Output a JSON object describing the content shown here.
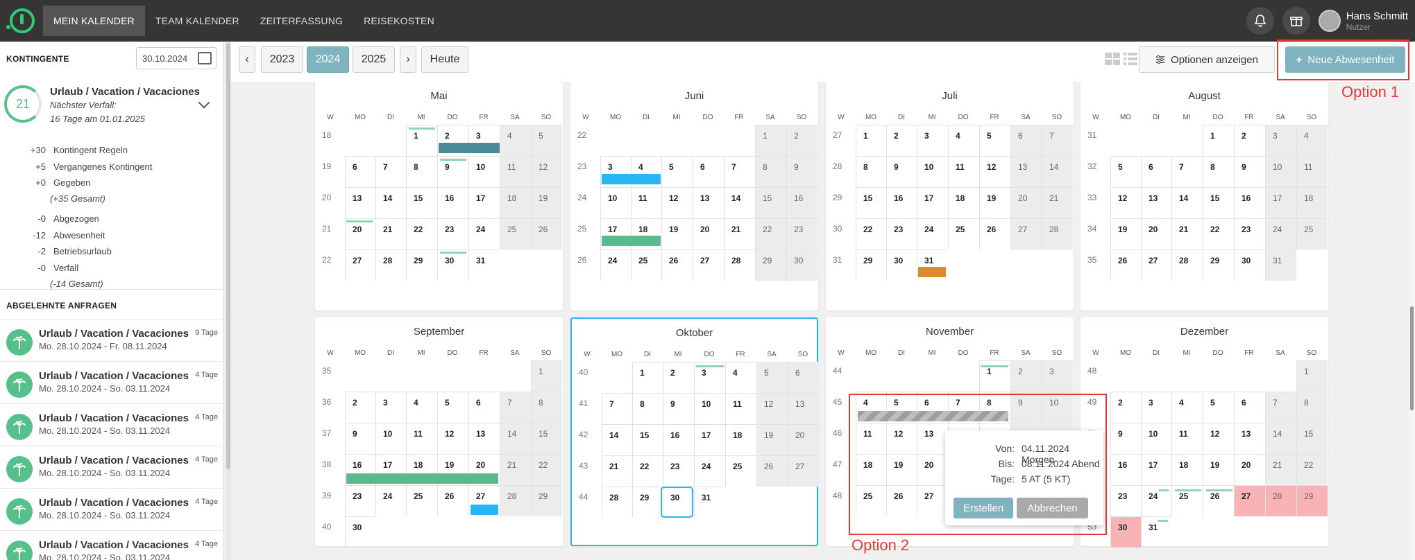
{
  "nav": {
    "items": [
      "MEIN KALENDER",
      "TEAM KALENDER",
      "ZEITERFASSUNG",
      "REISEKOSTEN"
    ],
    "active": 0
  },
  "user": {
    "name": "Hans Schmitt",
    "role": "Nutzer"
  },
  "sidebar": {
    "kontingente_title": "KONTINGENTE",
    "date": "30.10.2024",
    "quota": {
      "value": "21",
      "title": "Urlaub / Vacation / Vacaciones",
      "next_label": "Nächster Verfall:",
      "next_value": "16 Tage am 01.01.2025"
    },
    "rows": [
      {
        "n": "+30",
        "l": "Kontingent Regeln"
      },
      {
        "n": "+5",
        "l": "Vergangenes Kontingent"
      },
      {
        "n": "+0",
        "l": "Gegeben"
      },
      {
        "n": "",
        "l": "(+35 Gesamt)",
        "italic": true
      },
      {
        "n": "-0",
        "l": "Abgezogen"
      },
      {
        "n": "-12",
        "l": "Abwesenheit"
      },
      {
        "n": "-2",
        "l": "Betriebsurlaub"
      },
      {
        "n": "-0",
        "l": "Verfall"
      },
      {
        "n": "",
        "l": "(-14 Gesamt)",
        "italic": true
      }
    ],
    "rejected_title": "ABGELEHNTE ANFRAGEN",
    "requests": [
      {
        "title": "Urlaub / Vacation / Vacaciones",
        "dates": "Mo. 28.10.2024 - Fr. 08.11.2024",
        "count": "9 Tage"
      },
      {
        "title": "Urlaub / Vacation / Vacaciones",
        "dates": "Mo. 28.10.2024 - So. 03.11.2024",
        "count": "4 Tage"
      },
      {
        "title": "Urlaub / Vacation / Vacaciones",
        "dates": "Mo. 28.10.2024 - So. 03.11.2024",
        "count": "4 Tage"
      },
      {
        "title": "Urlaub / Vacation / Vacaciones",
        "dates": "Mo. 28.10.2024 - So. 03.11.2024",
        "count": "4 Tage"
      },
      {
        "title": "Urlaub / Vacation / Vacaciones",
        "dates": "Mo. 28.10.2024 - So. 03.11.2024",
        "count": "4 Tage"
      },
      {
        "title": "Urlaub / Vacation / Vacaciones",
        "dates": "Mo. 28.10.2024 - So. 03.11.2024",
        "count": "4 Tage"
      }
    ]
  },
  "toolbar": {
    "prev": "‹",
    "next": "›",
    "years": [
      "2023",
      "2024",
      "2025"
    ],
    "selected_year": "2024",
    "today": "Heute",
    "options": "Optionen anzeigen",
    "new": "Neue Abwesenheit"
  },
  "annotations": {
    "option1": "Option 1",
    "option2": "Option 2"
  },
  "weekday_headers": [
    "W",
    "MO",
    "DI",
    "MI",
    "DO",
    "FR",
    "SA",
    "SO"
  ],
  "months": [
    {
      "name": "Mai",
      "first_weekday": 2,
      "days": 31,
      "first_kw": 18
    },
    {
      "name": "Juni",
      "first_weekday": 5,
      "days": 30,
      "first_kw": 22
    },
    {
      "name": "Juli",
      "first_weekday": 0,
      "days": 31,
      "first_kw": 27
    },
    {
      "name": "August",
      "first_weekday": 3,
      "days": 31,
      "first_kw": 31
    },
    {
      "name": "September",
      "first_weekday": 6,
      "days": 30,
      "first_kw": 35
    },
    {
      "name": "Oktober",
      "first_weekday": 1,
      "days": 31,
      "first_kw": 40
    },
    {
      "name": "November",
      "first_weekday": 4,
      "days": 30,
      "first_kw": 44
    },
    {
      "name": "Dezember",
      "first_weekday": 6,
      "days": 31,
      "first_kw": 48
    }
  ],
  "colors": {
    "teal": "#4b8b96",
    "blue": "#29b6f6",
    "green": "#5cb98a",
    "orange": "#d98a2b",
    "hatched": "#9e9e9e",
    "red": "#f8b4b4",
    "accent": "#7fb3bf"
  },
  "popup": {
    "von_label": "Von:",
    "von": "04.11.2024 Morgen",
    "bis_label": "Bis:",
    "bis": "08.11.2024 Abend",
    "tage_label": "Tage:",
    "tage": "5 AT (5 KT)",
    "create": "Erstellen",
    "cancel": "Abbrechen"
  }
}
